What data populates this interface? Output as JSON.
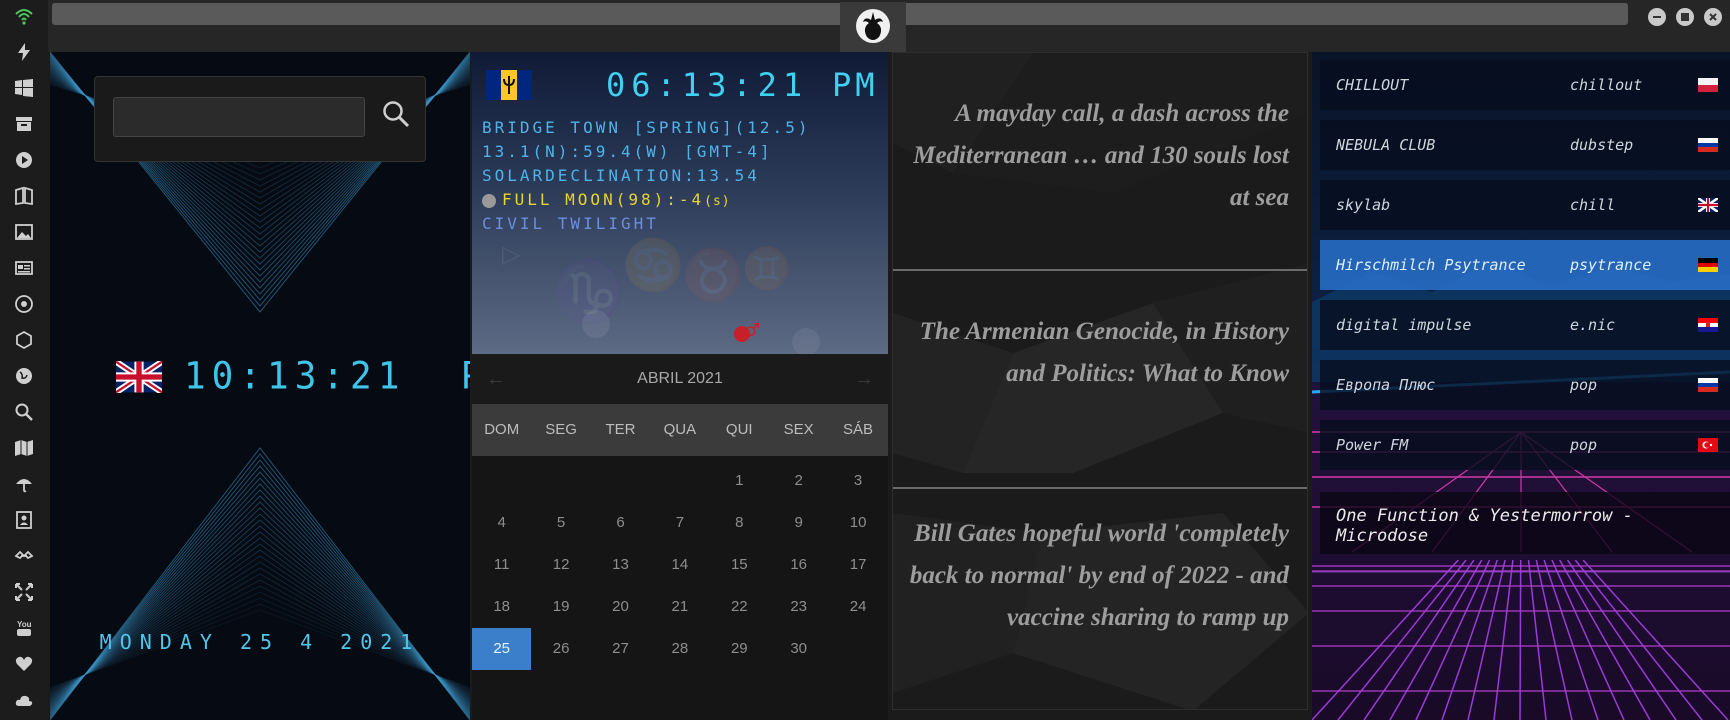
{
  "icons": [
    "wifi-icon",
    "lightning-icon",
    "windows-icon",
    "archive-icon",
    "play-icon",
    "book-icon",
    "image-icon",
    "news-icon",
    "sun-icon",
    "hexagon-icon",
    "globe-icon",
    "search-icon",
    "map-icon",
    "umbrella-icon",
    "contact-icon",
    "link-icon",
    "expand-icon",
    "youtube-icon",
    "heart-icon",
    "cloud-icon"
  ],
  "world_clock": {
    "search_placeholder": "",
    "time": "10:13:21",
    "ampm": "PM",
    "date": "MONDAY 25 4 2021"
  },
  "astro": {
    "time": "06:13:21",
    "ampm": "PM",
    "line1": "BRIDGE TOWN [SPRING](12.5)",
    "line2": "13.1(N):59.4(W) [GMT-4]",
    "line3": "SOLARDECLINATION:13.54",
    "moon": "FULL MOON(98):-4",
    "moon_suffix": "(s)",
    "line5": "CIVIL TWILIGHT"
  },
  "calendar": {
    "month": "ABRIL 2021",
    "weekdays": [
      "DOM",
      "SEG",
      "TER",
      "QUA",
      "QUI",
      "SEX",
      "SÁB"
    ],
    "first_weekday": 4,
    "days_in_month": 30,
    "selected": 25
  },
  "news": [
    "A mayday call, a dash across the Mediterranean … and 130 souls lost at sea",
    "The Armenian Genocide, in History and Politics: What to Know",
    "Bill Gates hopeful world 'completely back to normal' by end of 2022 - and vaccine sharing to ramp up"
  ],
  "radio": [
    {
      "name": "CHILLOUT",
      "genre": "chillout",
      "flag": "poland"
    },
    {
      "name": "NEBULA CLUB",
      "genre": "dubstep",
      "flag": "russia"
    },
    {
      "name": "skylab",
      "genre": "chill",
      "flag": "uk"
    },
    {
      "name": "Hirschmilch Psytrance",
      "genre": "psytrance",
      "flag": "germany"
    },
    {
      "name": "digital impulse",
      "genre": "e.nic",
      "flag": "croatia"
    },
    {
      "name": "Европа Плюс",
      "genre": "pop",
      "flag": "russia"
    },
    {
      "name": "Power FM",
      "genre": "pop",
      "flag": "turkey"
    }
  ],
  "now_playing": "One Function & Yestermorrow - Microdose",
  "colors": {
    "accent": "#3fc4ea",
    "calendar_selected": "#3b7fca",
    "radio_highlight": "#2a6ec8"
  }
}
